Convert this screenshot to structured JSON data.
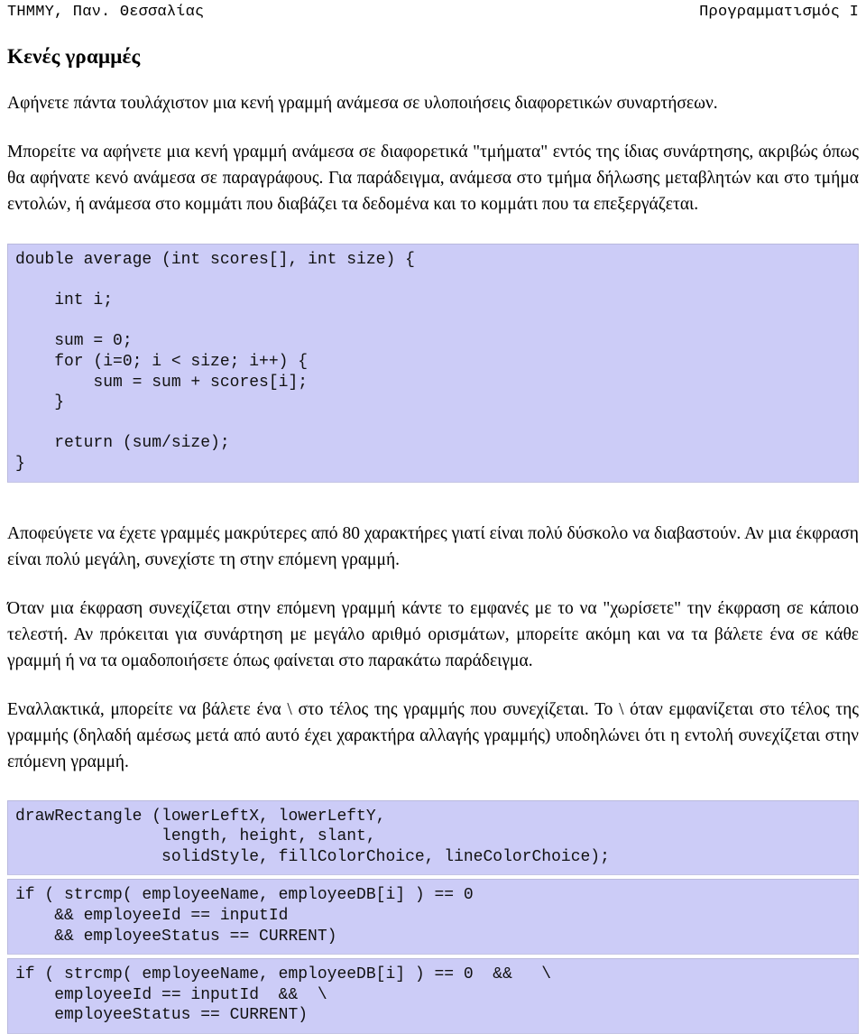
{
  "header": {
    "left": "ΤΗΜΜΥ, Παν. Θεσσαλίας",
    "right": "Προγραμματισμός Ι"
  },
  "section": {
    "title": "Κενές γραμμές"
  },
  "paragraphs": {
    "p1": "Αφήνετε πάντα τουλάχιστον μια κενή γραμμή ανάμεσα σε υλοποιήσεις διαφορετικών συναρτήσεων.",
    "p2": "Μπορείτε να αφήνετε μια κενή γραμμή ανάμεσα σε διαφορετικά \"τμήματα\" εντός της ίδιας συνάρτησης, ακριβώς όπως θα αφήνατε κενό ανάμεσα σε παραγράφους. Για παράδειγμα, ανάμεσα στο τμήμα δήλωσης μεταβλητών και στο τμήμα εντολών, ή ανάμεσα στο κομμάτι που διαβάζει τα δεδομένα και το κομμάτι που τα επεξεργάζεται.",
    "p3": "Αποφεύγετε να έχετε γραμμές μακρύτερες από 80 χαρακτήρες γιατί είναι πολύ δύσκολο να διαβαστούν. Αν μια έκφραση είναι πολύ μεγάλη, συνεχίστε τη στην επόμενη γραμμή.",
    "p4": "Όταν μια έκφραση συνεχίζεται στην επόμενη γραμμή κάντε το εμφανές με το να \"χωρίσετε\" την έκφραση σε κάποιο τελεστή. Αν πρόκειται για συνάρτηση με μεγάλο αριθμό ορισμάτων, μπορείτε ακόμη και να τα βάλετε ένα σε κάθε γραμμή ή να τα ομαδοποιήσετε όπως φαίνεται στο παρακάτω παράδειγμα.",
    "p5": "Εναλλακτικά, μπορείτε να βάλετε ένα \\ στο τέλος της γραμμής που συνεχίζεται. Το \\ όταν εμφανίζεται στο τέλος της γραμμής (δηλαδή αμέσως μετά από αυτό έχει χαρακτήρα αλλαγής γραμμής) υποδηλώνει ότι η εντολή συνεχίζεται στην επόμενη γραμμή."
  },
  "code_blocks": {
    "average_function": "double average (int scores[], int size) {\n\n    int i;\n\n    sum = 0;\n    for (i=0; i < size; i++) {\n        sum = sum + scores[i];\n    }\n\n    return (sum/size);\n}",
    "draw_rectangle": "drawRectangle (lowerLeftX, lowerLeftY,\n               length, height, slant,\n               solidStyle, fillColorChoice, lineColorChoice);",
    "if_operator_split": "if ( strcmp( employeeName, employeeDB[i] ) == 0\n    && employeeId == inputId\n    && employeeStatus == CURRENT)",
    "if_backslash_split": "if ( strcmp( employeeName, employeeDB[i] ) == 0  &&   \\\n    employeeId == inputId  &&  \\\n    employeeStatus == CURRENT)"
  },
  "colors": {
    "code_background": "#ccccf7",
    "code_border": "#b9b9dd",
    "page_background": "#ffffff",
    "text": "#000000"
  }
}
